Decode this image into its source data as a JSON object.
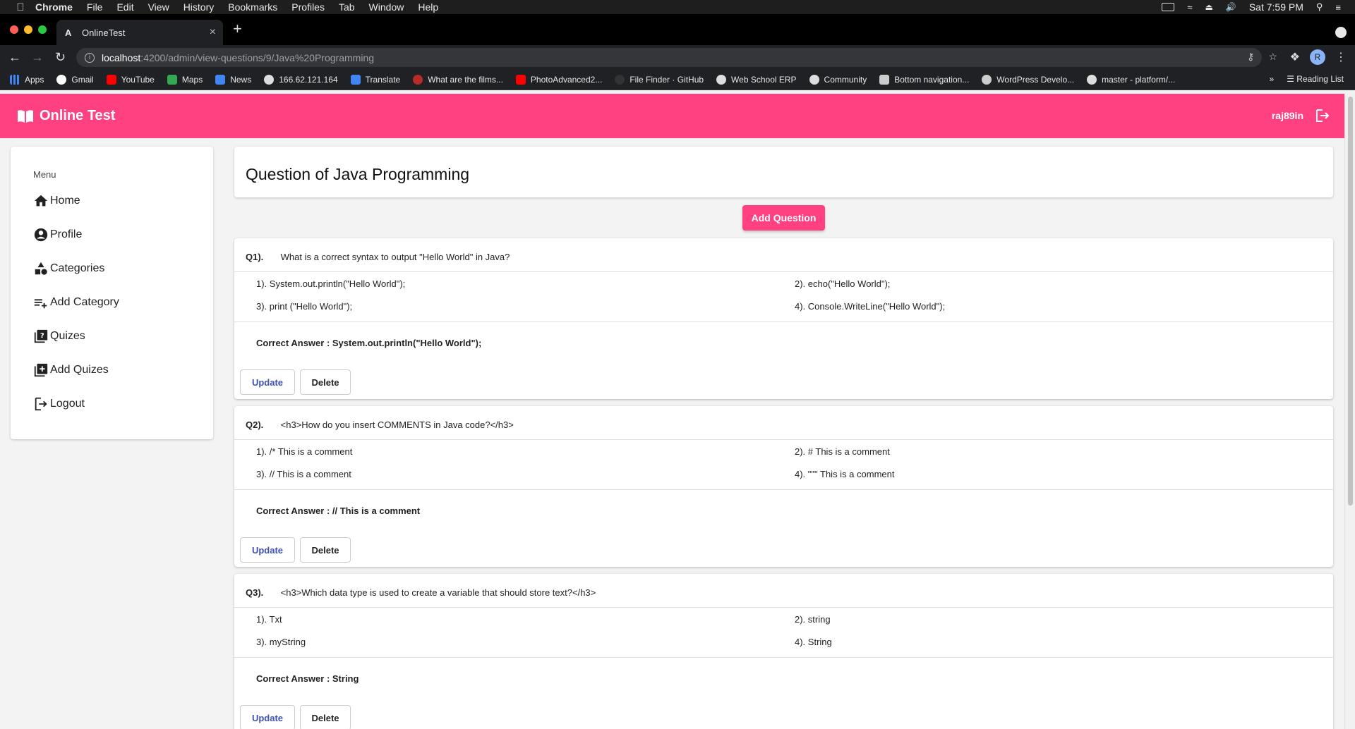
{
  "mac_menu": {
    "items": [
      "Chrome",
      "File",
      "Edit",
      "View",
      "History",
      "Bookmarks",
      "Profiles",
      "Tab",
      "Window",
      "Help"
    ],
    "clock": "Sat 7:59 PM"
  },
  "browser": {
    "tab_title": "OnlineTest",
    "tab_favicon": "A",
    "url_host": "localhost",
    "url_path": ":4200/admin/view-questions/9/Java%20Programming",
    "profile_initial": "R",
    "bookmarks": [
      "Apps",
      "Gmail",
      "YouTube",
      "Maps",
      "News",
      "166.62.121.164",
      "Translate",
      "What are the films...",
      "PhotoAdvanced2...",
      "File Finder · GitHub",
      "Web School ERP",
      "Community",
      "Bottom navigation...",
      "WordPress Develo...",
      "master - platform/..."
    ],
    "overflow": "»",
    "reading_list": "Reading List"
  },
  "app": {
    "brand": "Online Test",
    "username": "raj89in",
    "accent": "#ff4081"
  },
  "sidebar": {
    "menu_title": "Menu",
    "items": [
      {
        "label": "Home",
        "icon": "home-icon"
      },
      {
        "label": "Profile",
        "icon": "account-circle-icon"
      },
      {
        "label": "Categories",
        "icon": "category-icon"
      },
      {
        "label": "Add Category",
        "icon": "playlist-add-icon"
      },
      {
        "label": "Quizes",
        "icon": "quiz-icon"
      },
      {
        "label": "Add Quizes",
        "icon": "library-add-icon"
      },
      {
        "label": "Logout",
        "icon": "logout-icon"
      }
    ]
  },
  "main": {
    "title": "Question of Java Programming",
    "add_button": "Add Question",
    "update_label": "Update",
    "delete_label": "Delete",
    "questions": [
      {
        "num": "Q1).",
        "text": "What is a correct syntax to output \"Hello World\" in Java?",
        "options": [
          "1). System.out.println(\"Hello World\");",
          "2). echo(\"Hello World\");",
          "3). print (\"Hello World\");",
          "4). Console.WriteLine(\"Hello World\");"
        ],
        "answer": "Correct Answer : System.out.println(\"Hello World\");"
      },
      {
        "num": "Q2).",
        "text": "<h3>How do you insert COMMENTS in Java code?</h3>",
        "options": [
          "1). /* This is a comment",
          "2). # This is a comment",
          "3). // This is a comment",
          "4). \"\"\" This is a comment"
        ],
        "answer": "Correct Answer : // This is a comment"
      },
      {
        "num": "Q3).",
        "text": "<h3>Which data type is used to create a variable that should store text?</h3>",
        "options": [
          "1). Txt",
          "2). string",
          "3). myString",
          "4). String"
        ],
        "answer": "Correct Answer : String"
      }
    ]
  }
}
